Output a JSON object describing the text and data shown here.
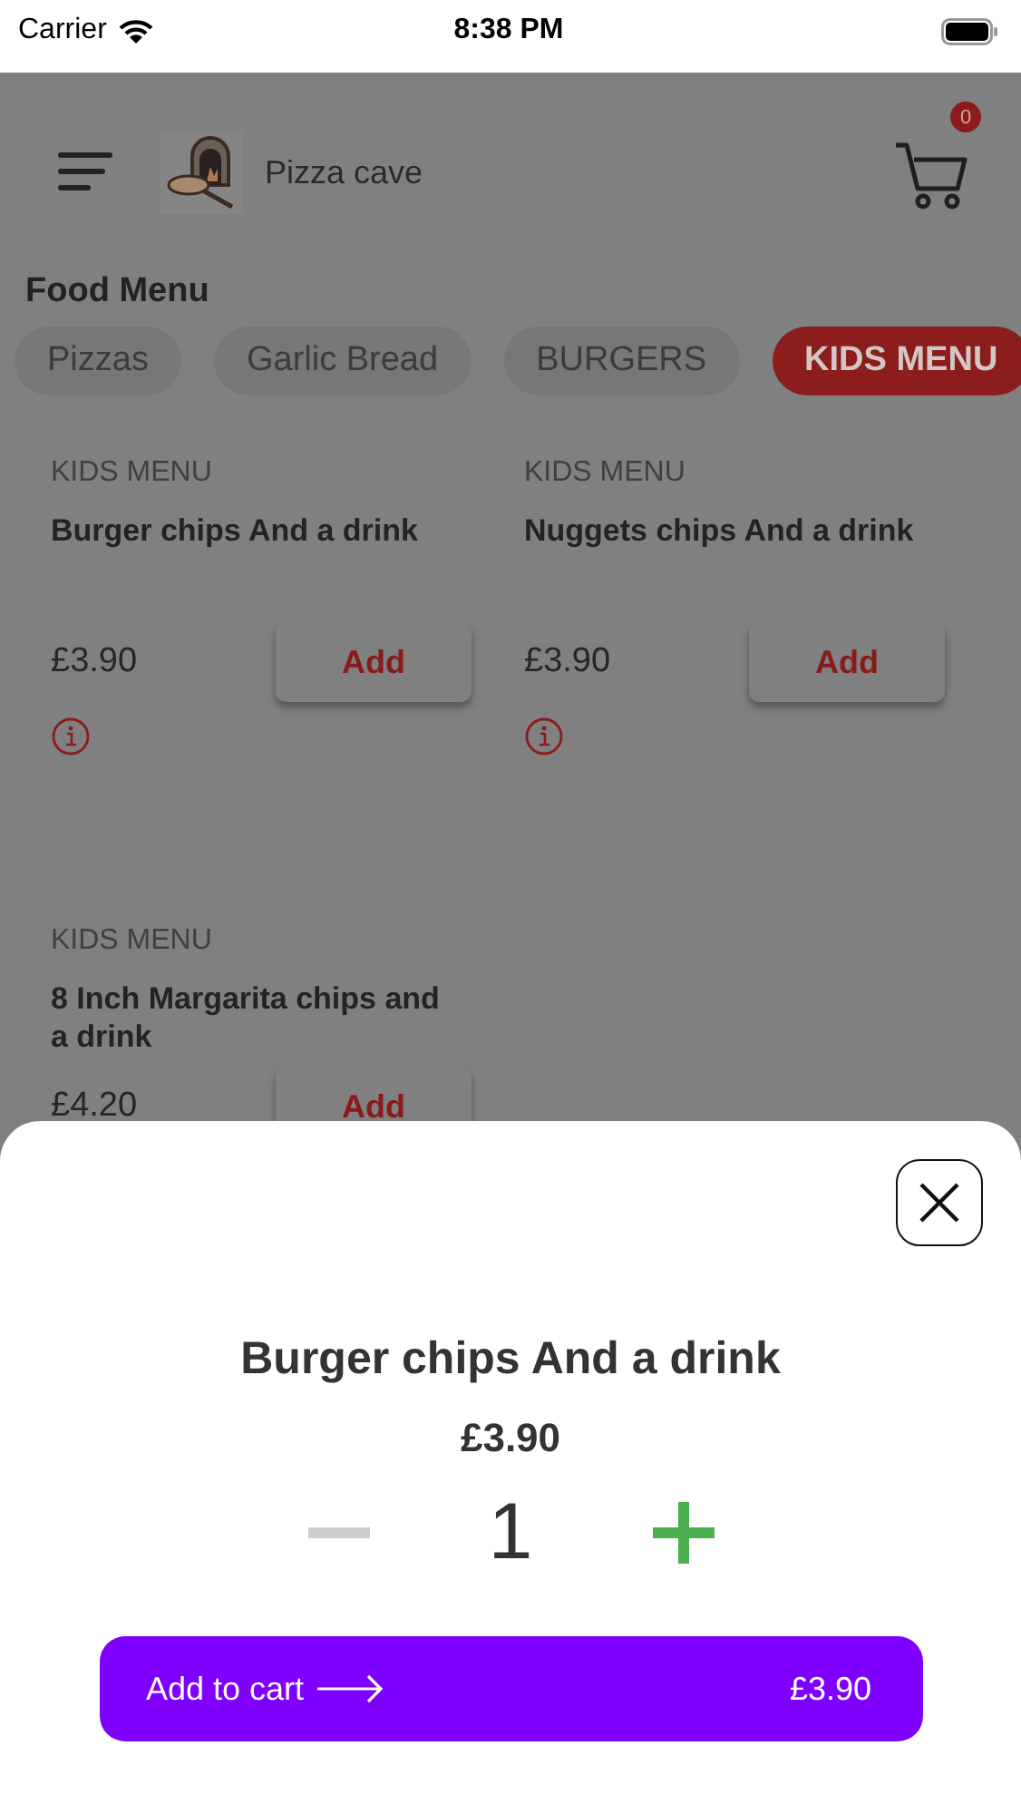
{
  "status_bar": {
    "carrier": "Carrier",
    "time": "8:38 PM"
  },
  "header": {
    "title": "Pizza cave",
    "cart_count": "0"
  },
  "section_title": "Food Menu",
  "tabs": [
    {
      "label": "Pizzas",
      "selected": false
    },
    {
      "label": "Garlic Bread",
      "selected": false
    },
    {
      "label": "BURGERS",
      "selected": false
    },
    {
      "label": "KIDS MENU",
      "selected": true
    }
  ],
  "items": [
    {
      "category": "KIDS MENU",
      "name": "Burger chips And a drink",
      "price": "£3.90",
      "button": "Add",
      "has_info": true
    },
    {
      "category": "KIDS MENU",
      "name": "Nuggets chips And a drink",
      "price": "£3.90",
      "button": "Add",
      "has_info": true
    },
    {
      "category": "KIDS MENU",
      "name": "8 Inch Margarita chips and a drink",
      "price": "£4.20",
      "button": "Add"
    }
  ],
  "sheet": {
    "name": "Burger chips And a drink",
    "price": "£3.90",
    "quantity": "1",
    "minus_disabled": true,
    "add_button": {
      "label": "Add to cart",
      "price": "£3.90"
    }
  }
}
